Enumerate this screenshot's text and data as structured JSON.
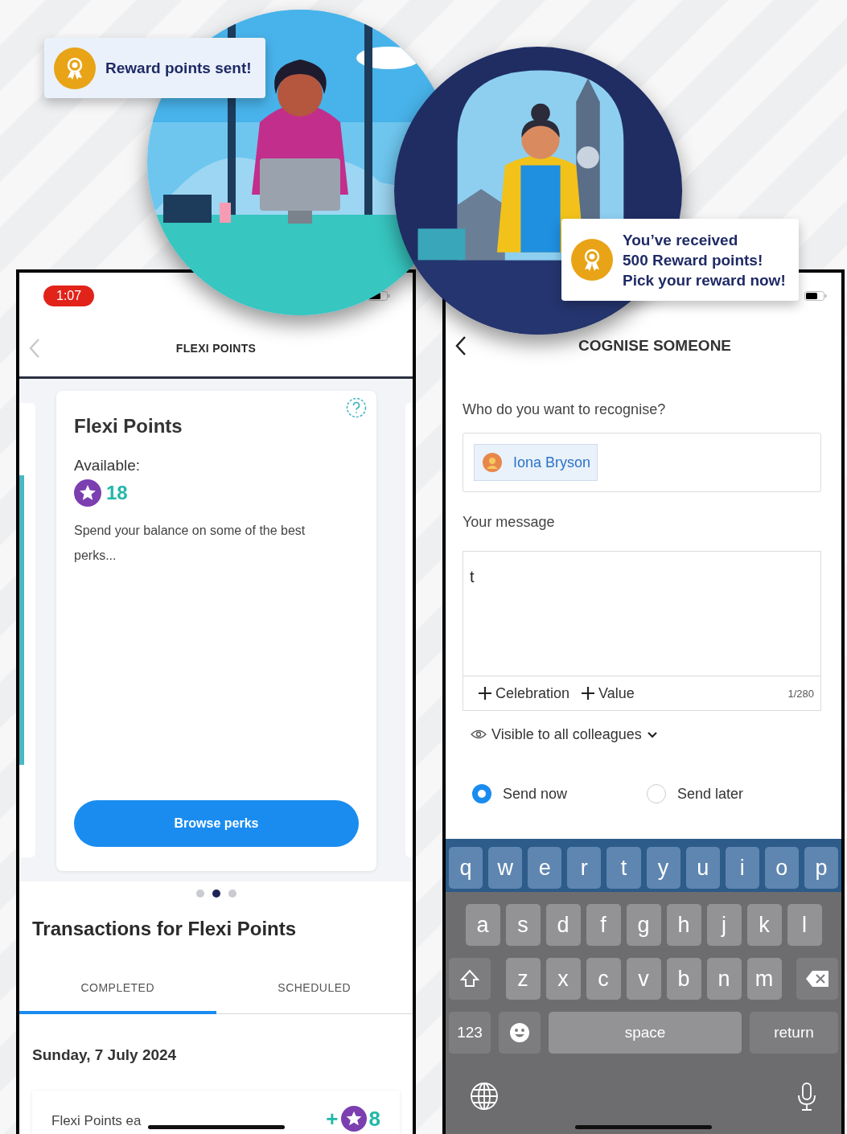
{
  "sent_toast": {
    "text": "Reward points sent!"
  },
  "received_toast": {
    "lines": [
      "You’ve received",
      "500 Reward points!",
      "Pick your reward now!"
    ]
  },
  "left_phone": {
    "time": "1:07",
    "title": "FLEXI POINTS",
    "card": {
      "title": "Flexi Points",
      "available_label": "Available:",
      "balance": "18",
      "description": "Spend your balance on some of the best perks...",
      "button": "Browse perks"
    },
    "pager": [
      {
        "selected": false
      },
      {
        "selected": true
      },
      {
        "selected": false
      }
    ],
    "section_title": "Transactions for Flexi Points",
    "tabs": [
      {
        "label": "COMPLETED",
        "selected": true
      },
      {
        "label": "SCHEDULED",
        "selected": false
      }
    ],
    "date": "Sunday, 7 July 2024",
    "transaction": {
      "label": "Flexi Points ea",
      "sign": "+",
      "amount": "8"
    }
  },
  "right_phone": {
    "title": "COGNISE SOMEONE",
    "recipient_label": "Who do you want to recognise?",
    "recipient": "Iona Bryson",
    "message_label": "Your message",
    "message": "t",
    "tags": [
      "Celebration",
      "Value"
    ],
    "counter": "1/280",
    "visibility": "Visible to all colleagues",
    "send_options": [
      {
        "label": "Send now",
        "selected": true
      },
      {
        "label": "Send later",
        "selected": false
      }
    ],
    "keyboard": {
      "letter_rows": [
        [
          "q",
          "w",
          "e",
          "r",
          "t",
          "y",
          "u",
          "i",
          "o",
          "p"
        ],
        [
          "a",
          "s",
          "d",
          "f",
          "g",
          "h",
          "j",
          "k",
          "l"
        ],
        [
          "z",
          "x",
          "c",
          "v",
          "b",
          "n",
          "m"
        ]
      ],
      "numbers_key": "123",
      "space_key": "space",
      "return_key": "return"
    }
  }
}
